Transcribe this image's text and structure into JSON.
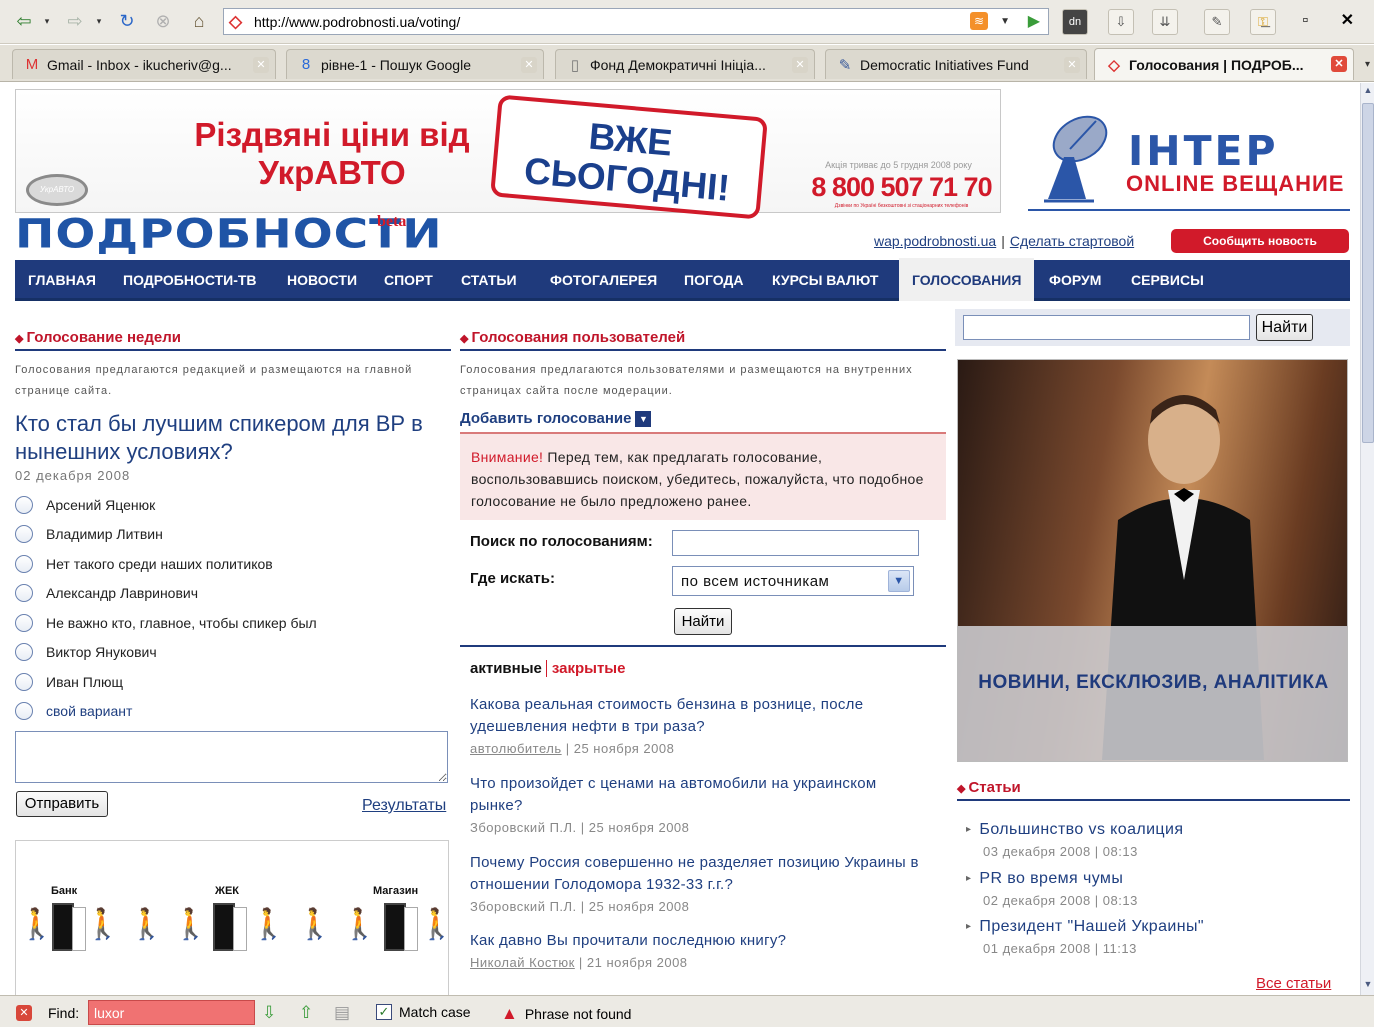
{
  "browser": {
    "url": "http://www.podrobnosti.ua/voting/",
    "tabs": [
      {
        "label": "Gmail - Inbox - ikucheriv@g...",
        "icon": "gmail-icon"
      },
      {
        "label": "рівне-1 - Пошук Google",
        "icon": "google-icon"
      },
      {
        "label": "Фонд Демократичні Ініціа...",
        "icon": "page-icon"
      },
      {
        "label": "Democratic Initiatives Fund",
        "icon": "pen-icon"
      },
      {
        "label": "Голосования | ПОДРОБ...",
        "icon": "site-icon",
        "active": true
      }
    ]
  },
  "ads": {
    "ukrauto_title": "Різдвяні ціни від УкрАВТО",
    "ukrauto_logo": "УкрАВТО",
    "today": "ВЖЕ СЬОГОДНІ!",
    "promo_note": "Акція триває до 5 грудня 2008 року",
    "phone": "8 800 507 71 70",
    "phone_note": "Дзвінки по Україні безкоштовні зі стаціонарних телефонів",
    "inter_brand": "ІНТЕР",
    "inter_tag": "ONLINE ВЕЩАНИЕ"
  },
  "site": {
    "logo": "ПОДРОБНОСТИ",
    "beta": "beta",
    "link_wap": "wap.podrobnosti.ua",
    "link_start": "Сделать стартовой",
    "report_btn": "Сообщить новость"
  },
  "nav": [
    "ГЛАВНАЯ",
    "ПОДРОБНОСТИ-ТВ",
    "НОВОСТИ",
    "СПОРТ",
    "СТАТЬИ",
    "ФОТОГАЛЕРЕЯ",
    "ПОГОДА",
    "КУРСЫ ВАЛЮТ",
    "ГОЛОСОВАНИЯ",
    "ФОРУМ",
    "СЕРВИСЫ"
  ],
  "left": {
    "heading": "Голосование недели",
    "note": "Голосования предлагаются редакцией и размещаются на главной странице сайта.",
    "question": "Кто стал бы лучшим спикером для ВР в нынешних условиях?",
    "date": "02 декабря 2008",
    "options": [
      "Арсений Яценюк",
      "Владимир Литвин",
      "Нет такого среди наших политиков",
      "Александр Лавринович",
      "Не важно кто, главное, чтобы спикер был",
      "Виктор Янукович",
      "Иван Плющ",
      "свой вариант"
    ],
    "send": "Отправить",
    "results": "Результаты",
    "cartoon_labels": [
      "Банк",
      "ЖЕК",
      "Магазин"
    ]
  },
  "middle": {
    "heading": "Голосования пользователей",
    "note": "Голосования предлагаются пользователями и размещаются на внутренних страницах сайта после модерации.",
    "add": "Добавить голосование",
    "warn_lead": "Внимание!",
    "warn_text": " Перед тем, как предлагать голосование, воспользовавшись поиском, убедитесь, пожалуйста, что подобное голосование не было предложено ранее.",
    "search_label": "Поиск по голосованиям:",
    "where_label": "Где искать:",
    "where_value": "по всем источникам",
    "find": "Найти",
    "filter_active": "активные",
    "filter_closed": "закрытые",
    "items": [
      {
        "title": "Какова реальная стоимость бензина в рознице, после удешевления нефти в три раза?",
        "author": "автолюбитель",
        "date": " | 25 ноября 2008"
      },
      {
        "title": "Что произойдет с ценами на автомобили на украинском рынке?",
        "author": "Зборовский П.Л.",
        "date": " | 25 ноября 2008"
      },
      {
        "title": "Почему Россия совершенно не разделяет позицию Украины в отношении Голодомора 1932-33 г.г.?",
        "author": "Зборовский П.Л.",
        "date": " | 25 ноября 2008"
      },
      {
        "title": "Как давно Вы прочитали последнюю книгу?",
        "author": "Николай Костюк",
        "date": " | 21 ноября 2008"
      }
    ]
  },
  "right": {
    "find": "Найти",
    "promo_caption": "НОВИНИ, ЕКСКЛЮЗИВ, АНАЛІТИКА",
    "heading": "Статьи",
    "articles": [
      {
        "title": "Большинство vs коалиция",
        "meta": "03 декабря 2008 | 08:13"
      },
      {
        "title": "PR во время чумы",
        "meta": "02 декабря 2008 | 08:13"
      },
      {
        "title": "Президент \"Нашей Украины\"",
        "meta": "01 декабря 2008 | 11:13"
      }
    ],
    "all": "Все статьи"
  },
  "findbar": {
    "label": "Find:",
    "value": "luxor",
    "match_case": "Match case",
    "status": "Phrase not found"
  }
}
